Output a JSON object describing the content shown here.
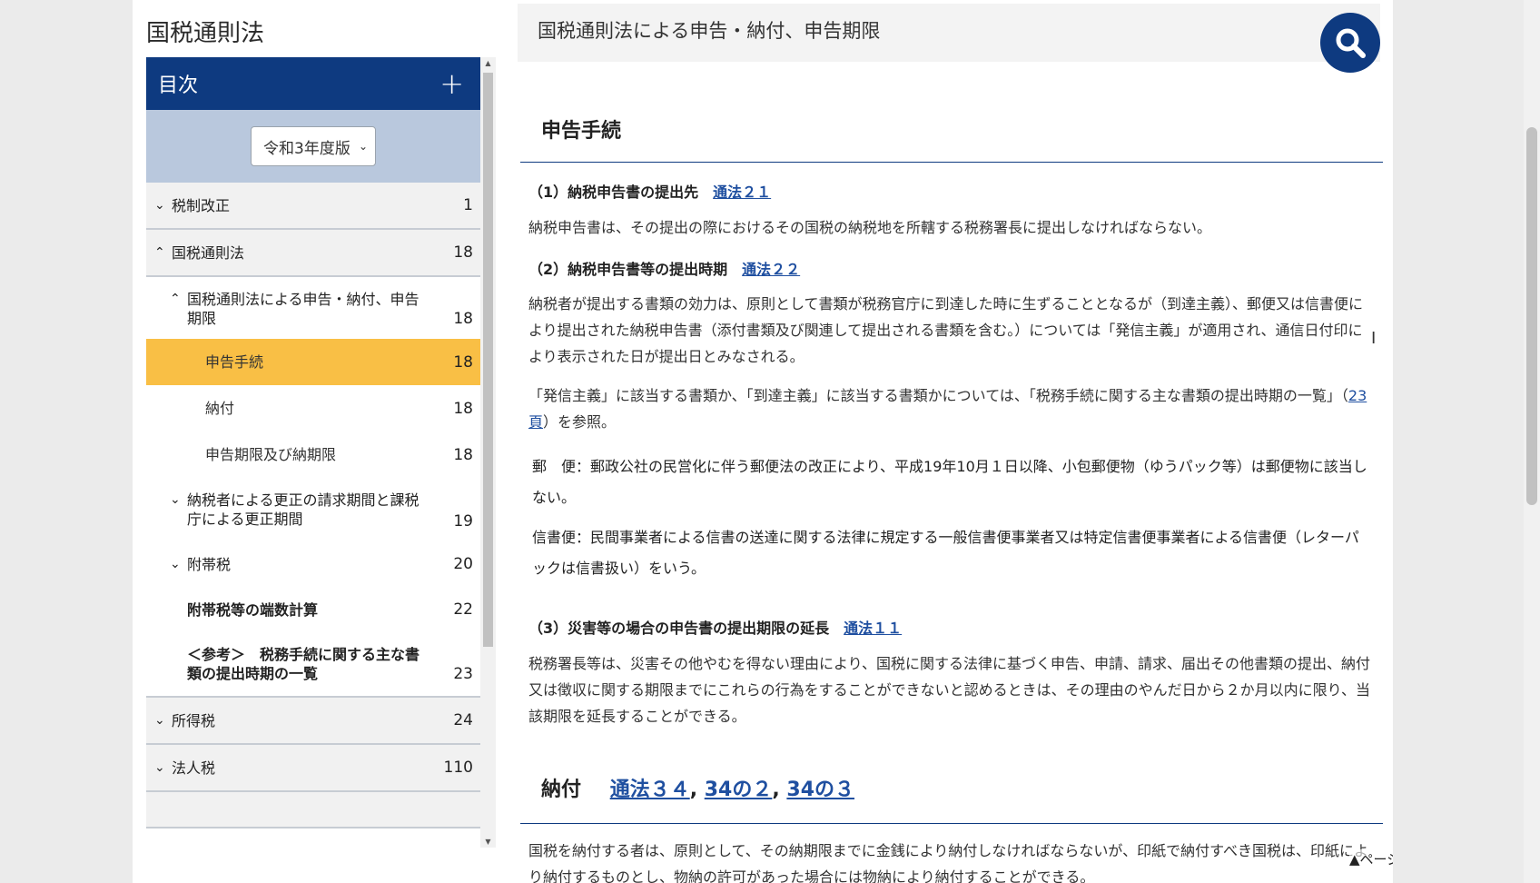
{
  "left": {
    "title": "国税通則法",
    "toc_label": "目次",
    "plus": "+",
    "version": "令和3年度版",
    "items": [
      {
        "level": 1,
        "arrow": "⌄",
        "label": "税制改正",
        "num": "1"
      },
      {
        "level": 1,
        "arrow": "⌃",
        "label": "国税通則法",
        "num": "18"
      },
      {
        "level": 2,
        "arrow": "⌃",
        "label": "国税通則法による申告・納付、申告期限",
        "num": "18"
      },
      {
        "level": 3,
        "label": "申告手続",
        "num": "18",
        "active": true
      },
      {
        "level": 3,
        "label": "納付",
        "num": "18"
      },
      {
        "level": 3,
        "label": "申告期限及び納期限",
        "num": "18"
      },
      {
        "level": 2,
        "arrow": "⌄",
        "label": "納税者による更正の請求期間と課税庁による更正期間",
        "num": "19"
      },
      {
        "level": 2,
        "arrow": "⌄",
        "label": "附帯税",
        "num": "20"
      },
      {
        "level": 2,
        "label": "附帯税等の端数計算",
        "num": "22",
        "bold": true
      },
      {
        "level": 2,
        "label": "＜参考＞　税務手続に関する主な書類の提出時期の一覧",
        "num": "23",
        "bold": true
      },
      {
        "level": 1,
        "arrow": "⌄",
        "label": "所得税",
        "num": "24"
      },
      {
        "level": 1,
        "arrow": "⌄",
        "label": "法人税",
        "num": "110"
      }
    ]
  },
  "main": {
    "header": "国税通則法による申告・納付、申告期限",
    "section1": "申告手続",
    "sub1": {
      "label": "（1）納税申告書の提出先",
      "link": "通法２１"
    },
    "p1": "納税申告書は、その提出の際におけるその国税の納税地を所轄する税務署長に提出しなければならない。",
    "sub2": {
      "label": "（2）納税申告書等の提出時期",
      "link": "通法２２"
    },
    "p2": "納税者が提出する書類の効力は、原則として書類が税務官庁に到達した時に生ずることとなるが（到達主義）、郵便又は信書便により提出された納税申告書（添付書類及び関連して提出される書類を含む。）については「発信主義」が適用され、通信日付印により表示された日が提出日とみなされる。",
    "p3a": "「発信主義」に該当する書類か、「到達主義」に該当する書類かについては、「税務手続に関する主な書類の提出時期の一覧」（",
    "p3link": "23頁",
    "p3b": "）を参照。",
    "note1": "郵　便：郵政公社の民営化に伴う郵便法の改正により、平成19年10月１日以降、小包郵便物（ゆうパック等）は郵便物に該当しない。",
    "note2": "信書便：民間事業者による信書の送達に関する法律に規定する一般信書便事業者又は特定信書便事業者による信書便（レターパックは信書扱い）をいう。",
    "sub3": {
      "label": "（3）災害等の場合の申告書の提出期限の延長",
      "link": "通法１１"
    },
    "p4": "税務署長等は、災害その他やむを得ない理由により、国税に関する法律に基づく申告、申請、請求、届出その他書類の提出、納付又は徴収に関する期限までにこれらの行為をすることができないと認めるときは、その理由のやんだ日から２か月以内に限り、当該期限を延長することができる。",
    "section2": "納付",
    "section2_links": [
      "通法３４",
      "34の２",
      "34の３"
    ],
    "p5": "国税を納付する者は、原則として、その納期限までに金銭により納付しなければならないが、印紙で納付すべき国税は、印紙により納付するものとし、物納の許可があった場合には物納により納付することができる。",
    "back_to_top": "▲ページの先頭に戻る"
  },
  "colors": {
    "navy": "#0e3a80",
    "active": "#f9bf45",
    "link": "#1f4fa0"
  }
}
